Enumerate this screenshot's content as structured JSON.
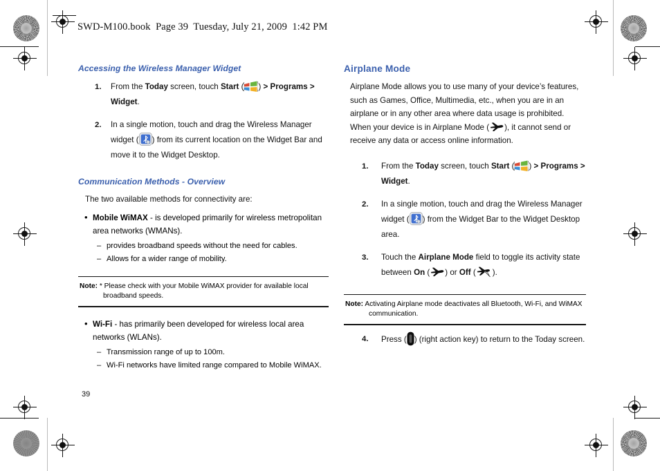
{
  "header": {
    "text": "SWD-M100.book  Page 39  Tuesday, July 21, 2009  1:42 PM"
  },
  "page_number": "39",
  "colors": {
    "heading_blue": "#3a5fad",
    "text_black": "#111111",
    "rule_black": "#111111"
  },
  "left_column": {
    "heading_1": "Accessing the Wireless Manager Widget",
    "steps": [
      {
        "num": "1.",
        "parts": [
          {
            "t": "From the ",
            "b": false
          },
          {
            "t": "Today",
            "b": true
          },
          {
            "t": " screen, touch ",
            "b": false
          },
          {
            "t": "Start",
            "b": true
          },
          {
            "t": " (",
            "b": false
          },
          {
            "icon": "windows-start-icon"
          },
          {
            "t": ") ",
            "b": false
          },
          {
            "t": "> Programs > Widget",
            "b": true
          },
          {
            "t": ".",
            "b": false
          }
        ]
      },
      {
        "num": "2.",
        "parts": [
          {
            "t": "In a single motion, touch and drag the Wireless Manager widget (",
            "b": false
          },
          {
            "icon": "wireless-manager-widget-icon"
          },
          {
            "t": ") from its current location on the Widget Bar and move it to the Widget Desktop.",
            "b": false
          }
        ]
      }
    ],
    "heading_2": "Communication Methods - Overview",
    "intro": "The two available methods for connectivity are:",
    "bullet_wimax": {
      "bullet": "•",
      "term": "Mobile WiMAX",
      "rest": " - is developed primarily for wireless metropolitan area networks (WMANs).",
      "sub": [
        "provides broadband speeds without the need for cables.",
        "Allows for a wider range of mobility."
      ]
    },
    "note": {
      "label": "Note:",
      "text": "* Please check with your Mobile WiMAX provider for available local",
      "cont": "broadband speeds."
    },
    "bullet_wifi": {
      "bullet": "•",
      "term": "Wi-Fi",
      "rest": " - has primarily been developed for wireless local area networks (WLANs).",
      "sub": [
        "Transmission range of up to 100m.",
        "Wi-Fi networks have limited range compared to Mobile WiMAX."
      ]
    },
    "dash": "–"
  },
  "right_column": {
    "heading": "Airplane Mode",
    "paragraph_parts": [
      {
        "t": "Airplane Mode allows you to use many of your device’s features, such as Games, Office, Multimedia, etc., when you are in an airplane or in any other area where data usage is prohibited. When your device is in Airplane Mode (",
        "b": false
      },
      {
        "icon": "airplane-on-icon"
      },
      {
        "t": "), it cannot send or receive any data or access online information.",
        "b": false
      }
    ],
    "steps": [
      {
        "num": "1.",
        "parts": [
          {
            "t": "From the ",
            "b": false
          },
          {
            "t": "Today",
            "b": true
          },
          {
            "t": " screen, touch ",
            "b": false
          },
          {
            "t": "Start",
            "b": true
          },
          {
            "t": " (",
            "b": false
          },
          {
            "icon": "windows-start-icon"
          },
          {
            "t": ") ",
            "b": false
          },
          {
            "t": "> Programs > Widget",
            "b": true
          },
          {
            "t": ".",
            "b": false
          }
        ]
      },
      {
        "num": "2.",
        "parts": [
          {
            "t": "In a single motion, touch and drag the Wireless Manager widget (",
            "b": false
          },
          {
            "icon": "wireless-manager-widget-icon"
          },
          {
            "t": ") from the Widget Bar to the Widget Desktop area.",
            "b": false
          }
        ]
      },
      {
        "num": "3.",
        "parts": [
          {
            "t": "Touch the ",
            "b": false
          },
          {
            "t": "Airplane Mode",
            "b": true
          },
          {
            "t": " field to toggle its activity state between ",
            "b": false
          },
          {
            "t": "On",
            "b": true
          },
          {
            "t": " (",
            "b": false
          },
          {
            "icon": "airplane-on-icon"
          },
          {
            "t": ") or ",
            "b": false
          },
          {
            "t": "Off",
            "b": true
          },
          {
            "t": " (",
            "b": false
          },
          {
            "icon": "airplane-off-icon"
          },
          {
            "t": ").",
            "b": false
          }
        ]
      }
    ],
    "note": {
      "label": "Note:",
      "text": "Activating Airplane mode deactivates all Bluetooth, Wi-Fi, and WiMAX",
      "cont": "communication."
    },
    "step_4": {
      "num": "4.",
      "parts": [
        {
          "t": "Press (",
          "b": false
        },
        {
          "icon": "right-action-key-icon"
        },
        {
          "t": ") (right action key) to return to the Today screen.",
          "b": false
        }
      ]
    }
  }
}
